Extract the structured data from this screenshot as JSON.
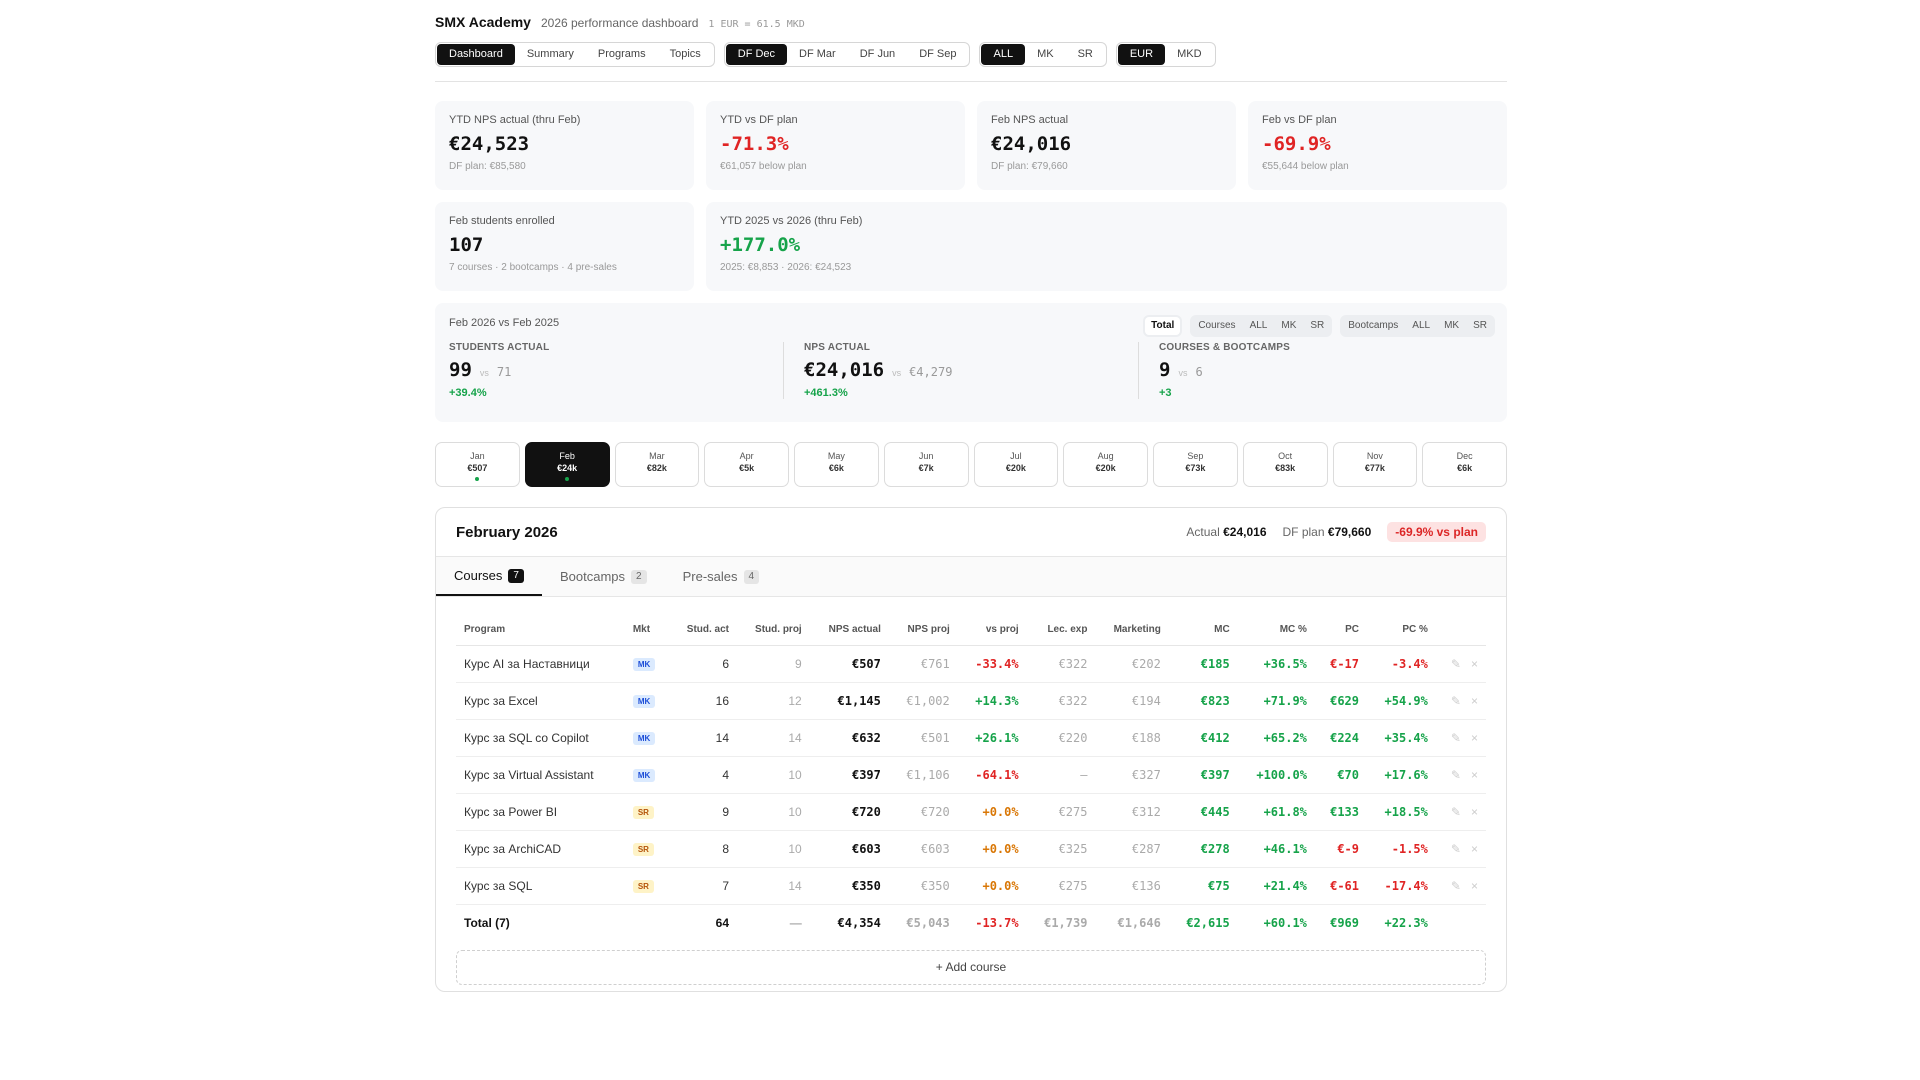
{
  "header": {
    "title": "SMX Academy",
    "subtitle": "2026 performance dashboard",
    "rate": "1 EUR = 61.5 MKD"
  },
  "nav": {
    "views": [
      "Dashboard",
      "Summary",
      "Programs",
      "Topics"
    ],
    "forecasts": [
      "DF Dec",
      "DF Mar",
      "DF Jun",
      "DF Sep"
    ],
    "markets": [
      "ALL",
      "MK",
      "SR"
    ],
    "currencies": [
      "EUR",
      "MKD"
    ]
  },
  "kpis": [
    {
      "label": "YTD NPS actual (thru Feb)",
      "value": "€24,523",
      "sub": "DF plan: €85,580"
    },
    {
      "label": "YTD vs DF plan",
      "value": "-71.3%",
      "sub": "€61,057 below plan"
    },
    {
      "label": "Feb NPS actual",
      "value": "€24,016",
      "sub": "DF plan: €79,660"
    },
    {
      "label": "Feb vs DF plan",
      "value": "-69.9%",
      "sub": "€55,644 below plan"
    },
    {
      "label": "Feb students enrolled",
      "value": "107",
      "sub": "7 courses · 2 bootcamps · 4 pre-sales"
    },
    {
      "label": "YTD 2025 vs 2026 (thru Feb)",
      "value": "+177.0%",
      "sub": "2025: €8,853 · 2026: €24,523"
    }
  ],
  "comparison": {
    "title": "Feb 2026 vs Feb 2025",
    "filters": {
      "total": "Total",
      "courses": [
        "Courses",
        "ALL",
        "MK",
        "SR"
      ],
      "bootcamps": [
        "Bootcamps",
        "ALL",
        "MK",
        "SR"
      ]
    },
    "vs": "vs",
    "metrics": [
      {
        "label": "STUDENTS ACTUAL",
        "value": "99",
        "prev": "71",
        "delta": "+39.4%"
      },
      {
        "label": "NPS ACTUAL",
        "value": "€24,016",
        "prev": "€4,279",
        "delta": "+461.3%"
      },
      {
        "label": "COURSES & BOOTCAMPS",
        "value": "9",
        "prev": "6",
        "delta": "+3"
      }
    ]
  },
  "months": [
    {
      "name": "Jan",
      "value": "€507",
      "dot": true
    },
    {
      "name": "Feb",
      "value": "€24k",
      "dot": true
    },
    {
      "name": "Mar",
      "value": "€82k",
      "dot": false
    },
    {
      "name": "Apr",
      "value": "€5k",
      "dot": false
    },
    {
      "name": "May",
      "value": "€6k",
      "dot": false
    },
    {
      "name": "Jun",
      "value": "€7k",
      "dot": false
    },
    {
      "name": "Jul",
      "value": "€20k",
      "dot": false
    },
    {
      "name": "Aug",
      "value": "€20k",
      "dot": false
    },
    {
      "name": "Sep",
      "value": "€73k",
      "dot": false
    },
    {
      "name": "Oct",
      "value": "€83k",
      "dot": false
    },
    {
      "name": "Nov",
      "value": "€77k",
      "dot": false
    },
    {
      "name": "Dec",
      "value": "€6k",
      "dot": false
    }
  ],
  "panel": {
    "title": "February 2026",
    "actual_label": "Actual",
    "actual_value": "€24,016",
    "plan_label": "DF plan",
    "plan_value": "€79,660",
    "badge": "-69.9% vs plan",
    "tabs": [
      {
        "label": "Courses",
        "count": "7"
      },
      {
        "label": "Bootcamps",
        "count": "2"
      },
      {
        "label": "Pre-sales",
        "count": "4"
      }
    ],
    "columns": [
      "Program",
      "Mkt",
      "Stud. act",
      "Stud. proj",
      "NPS actual",
      "NPS proj",
      "vs proj",
      "Lec. exp",
      "Marketing",
      "MC",
      "MC %",
      "PC",
      "PC %"
    ],
    "rows": [
      {
        "program": "Курс AI за Наставници",
        "mkt": "MK",
        "stud_act": "6",
        "stud_proj": "9",
        "nps_act": "€507",
        "nps_proj": "€761",
        "vs_proj": "-33.4%",
        "lec": "€322",
        "mkt_cost": "€202",
        "mc": "€185",
        "mc_pct": "+36.5%",
        "pc": "€-17",
        "pc_pct": "-3.4%"
      },
      {
        "program": "Курс за Excel",
        "mkt": "MK",
        "stud_act": "16",
        "stud_proj": "12",
        "nps_act": "€1,145",
        "nps_proj": "€1,002",
        "vs_proj": "+14.3%",
        "lec": "€322",
        "mkt_cost": "€194",
        "mc": "€823",
        "mc_pct": "+71.9%",
        "pc": "€629",
        "pc_pct": "+54.9%"
      },
      {
        "program": "Курс за SQL со Copilot",
        "mkt": "MK",
        "stud_act": "14",
        "stud_proj": "14",
        "nps_act": "€632",
        "nps_proj": "€501",
        "vs_proj": "+26.1%",
        "lec": "€220",
        "mkt_cost": "€188",
        "mc": "€412",
        "mc_pct": "+65.2%",
        "pc": "€224",
        "pc_pct": "+35.4%"
      },
      {
        "program": "Курс за Virtual Assistant",
        "mkt": "MK",
        "stud_act": "4",
        "stud_proj": "10",
        "nps_act": "€397",
        "nps_proj": "€1,106",
        "vs_proj": "-64.1%",
        "lec": "—",
        "mkt_cost": "€327",
        "mc": "€397",
        "mc_pct": "+100.0%",
        "pc": "€70",
        "pc_pct": "+17.6%"
      },
      {
        "program": "Курс за Power BI",
        "mkt": "SR",
        "stud_act": "9",
        "stud_proj": "10",
        "nps_act": "€720",
        "nps_proj": "€720",
        "vs_proj": "+0.0%",
        "lec": "€275",
        "mkt_cost": "€312",
        "mc": "€445",
        "mc_pct": "+61.8%",
        "pc": "€133",
        "pc_pct": "+18.5%"
      },
      {
        "program": "Курс за ArchiCAD",
        "mkt": "SR",
        "stud_act": "8",
        "stud_proj": "10",
        "nps_act": "€603",
        "nps_proj": "€603",
        "vs_proj": "+0.0%",
        "lec": "€325",
        "mkt_cost": "€287",
        "mc": "€278",
        "mc_pct": "+46.1%",
        "pc": "€-9",
        "pc_pct": "-1.5%"
      },
      {
        "program": "Курс за SQL",
        "mkt": "SR",
        "stud_act": "7",
        "stud_proj": "14",
        "nps_act": "€350",
        "nps_proj": "€350",
        "vs_proj": "+0.0%",
        "lec": "€275",
        "mkt_cost": "€136",
        "mc": "€75",
        "mc_pct": "+21.4%",
        "pc": "€-61",
        "pc_pct": "-17.4%"
      }
    ],
    "total": {
      "program": "Total (7)",
      "stud_act": "64",
      "stud_proj": "—",
      "nps_act": "€4,354",
      "nps_proj": "€5,043",
      "vs_proj": "-13.7%",
      "lec": "€1,739",
      "mkt_cost": "€1,646",
      "mc": "€2,615",
      "mc_pct": "+60.1%",
      "pc": "€969",
      "pc_pct": "+22.3%"
    },
    "edit_icon": "✎",
    "delete_icon": "×",
    "add_label": "+ Add course"
  },
  "colors": {
    "accent": "#111111",
    "negative": "#e02424",
    "positive": "#16a34a",
    "neutral": "#d97706"
  }
}
